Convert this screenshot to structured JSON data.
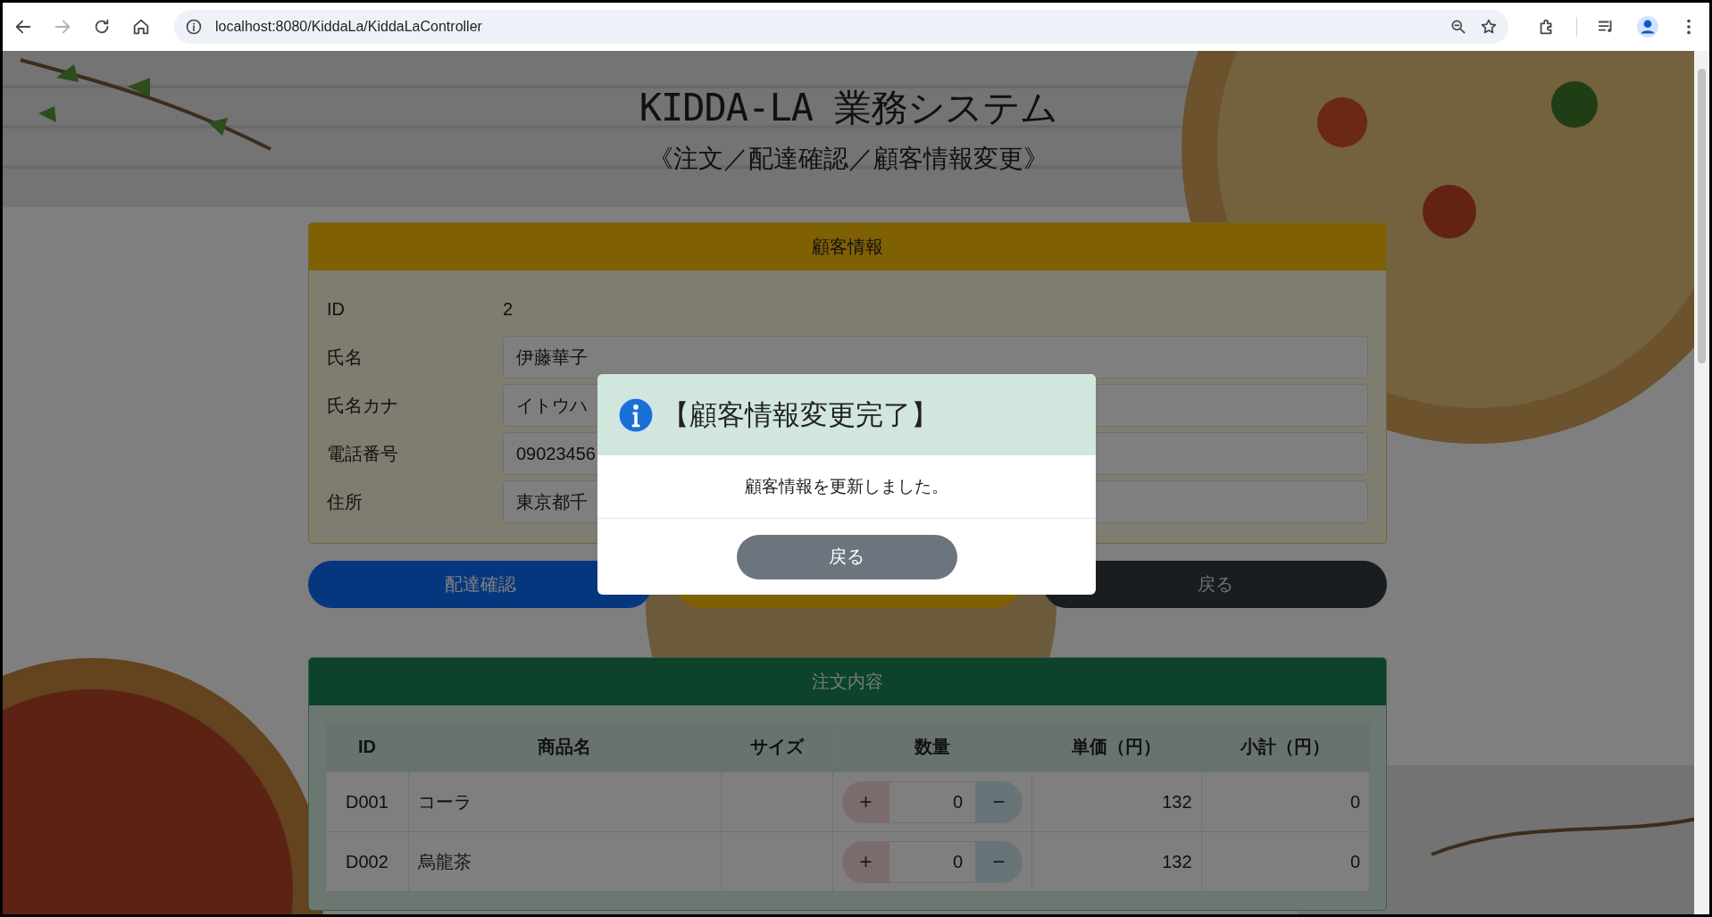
{
  "browser": {
    "url": "localhost:8080/KiddaLa/KiddaLaController"
  },
  "header": {
    "title": "KIDDA-LA 業務システム",
    "subtitle": "《注文／配達確認／顧客情報変更》"
  },
  "customer": {
    "title": "顧客情報",
    "id_label": "ID",
    "id_value": "2",
    "fields": [
      {
        "label": "氏名",
        "value": "伊藤華子"
      },
      {
        "label": "氏名カナ",
        "value": "イトウハ"
      },
      {
        "label": "電話番号",
        "value": "09023456"
      },
      {
        "label": "住所",
        "value": "東京都千"
      }
    ]
  },
  "actions": [
    {
      "kind": "primary",
      "label": "配達確認"
    },
    {
      "kind": "warning"
    },
    {
      "kind": "dark",
      "label": "戻る"
    }
  ],
  "order": {
    "title": "注文内容",
    "columns": [
      "ID",
      "商品名",
      "サイズ",
      "数量",
      "単価（円）",
      "小計（円）"
    ],
    "rows": [
      {
        "id": "D001",
        "name": "コーラ",
        "plus": "+",
        "quantity": "0",
        "minus": "−",
        "price": "132",
        "subtotal": "0"
      },
      {
        "id": "D002",
        "name": "烏龍茶",
        "plus": "+",
        "quantity": "0",
        "minus": "−",
        "price": "132",
        "subtotal": "0"
      }
    ]
  },
  "dialog": {
    "title": "【顧客情報変更完了】",
    "message": "顧客情報を更新しました。",
    "button": "戻る"
  }
}
